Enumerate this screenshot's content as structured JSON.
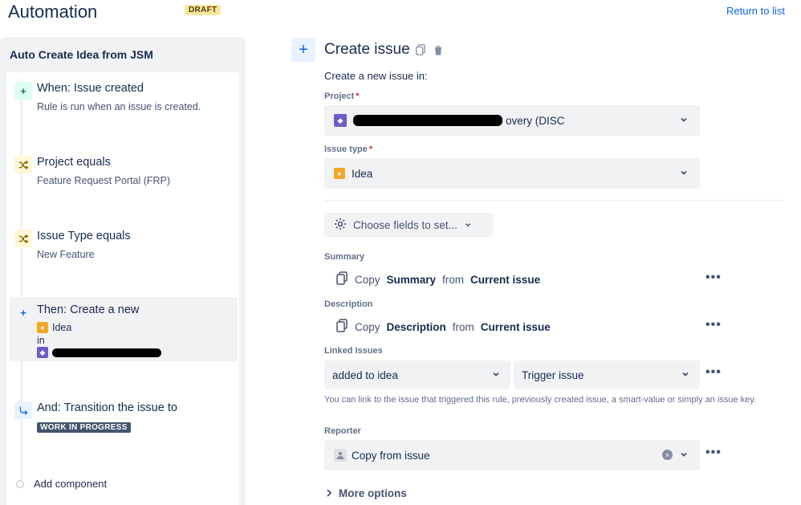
{
  "header": {
    "title": "Automation",
    "badge": "DRAFT",
    "return_link": "Return to list"
  },
  "rule": {
    "name": "Auto Create Idea from JSM",
    "steps": [
      {
        "icon": "plus-icon",
        "title": "When: Issue created",
        "subtitle": "Rule is run when an issue is created."
      },
      {
        "icon": "shuffle-icon",
        "title": "Project equals",
        "subtitle": "Feature Request Portal (FRP)"
      },
      {
        "icon": "shuffle-icon",
        "title": "Issue Type equals",
        "subtitle": "New Feature"
      },
      {
        "icon": "plus-icon",
        "title": "Then: Create a new",
        "issue_type": "Idea",
        "in_label": "in"
      },
      {
        "icon": "transition-icon",
        "title": "And: Transition the issue to",
        "status": "WORK IN PROGRESS"
      }
    ],
    "add_component": "Add component"
  },
  "panel": {
    "title": "Create issue",
    "intro": "Create a new issue in:",
    "project": {
      "label": "Project",
      "value": "overy (DISC"
    },
    "issue_type": {
      "label": "Issue type",
      "value": "Idea"
    },
    "choose_fields": "Choose fields to set...",
    "summary": {
      "label": "Summary",
      "copy": "Copy",
      "field": "Summary",
      "from": "from",
      "source": "Current issue"
    },
    "description": {
      "label": "Description",
      "copy": "Copy",
      "field": "Description",
      "from": "from",
      "source": "Current issue"
    },
    "linked_issues": {
      "label": "Linked Issues",
      "link_type": "added to idea",
      "target": "Trigger issue",
      "help": "You can link to the issue that triggered this rule, previously created issue, a smart-value or simply an issue key."
    },
    "reporter": {
      "label": "Reporter",
      "value": "Copy from issue"
    },
    "more_options": "More options"
  },
  "colors": {
    "accent": "#0c66e4",
    "draft_bg": "#f8e6a0",
    "idea_icon": "#f5a623",
    "project_icon": "#6e5dc6"
  }
}
